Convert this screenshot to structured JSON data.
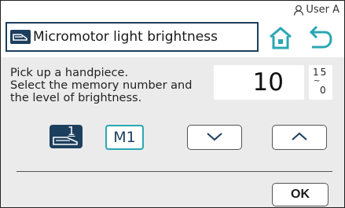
{
  "user": {
    "icon": "user-icon",
    "label": "User A"
  },
  "header": {
    "icon": "handpiece-icon",
    "title": "Micromotor light brightness",
    "home_icon": "home-icon",
    "back_icon": "back-arrow-icon"
  },
  "instructions": {
    "line1": "Pick up a handpiece.",
    "line2": "Select the memory number and",
    "line3": "the level of brightness."
  },
  "value": {
    "current": "10",
    "range_max": "15",
    "range_separator": "~",
    "range_min": "0"
  },
  "controls": {
    "handpiece_number": "1",
    "memory_label": "M1",
    "down_icon": "chevron-down-icon",
    "up_icon": "chevron-up-icon",
    "ok_label": "OK"
  },
  "colors": {
    "accent_dark": "#1d3f5e",
    "accent_teal": "#2aa7b3",
    "panel_gray": "#ebebeb"
  }
}
